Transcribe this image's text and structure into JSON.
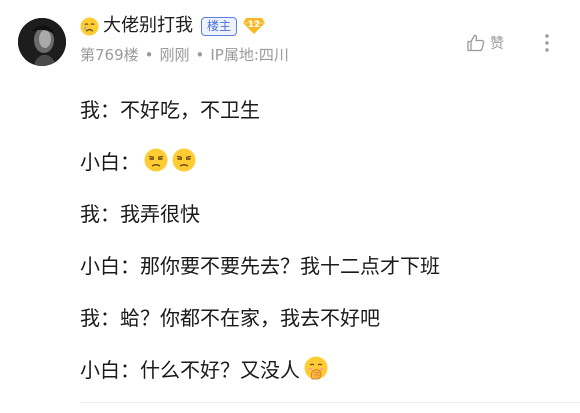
{
  "author": {
    "name": "大佬别打我",
    "name_emoji": "crying-face-icon",
    "op_badge": "楼主",
    "level": "12"
  },
  "meta": {
    "floor": "第769楼",
    "time": "刚刚",
    "ip": "IP属地:四川"
  },
  "actions": {
    "like_label": "赞",
    "like_icon": "thumbs-up-icon",
    "more_icon": "more-vertical-icon"
  },
  "messages": [
    {
      "speaker": "我：",
      "text": "不好吃，不卫生",
      "emojis": []
    },
    {
      "speaker": "小白：",
      "text": "",
      "emojis": [
        "unamused-face-icon",
        "unamused-face-icon"
      ]
    },
    {
      "speaker": "我：",
      "text": "我弄很快",
      "emojis": []
    },
    {
      "speaker": "小白：",
      "text": "那你要不要先去？我十二点才下班",
      "emojis": []
    },
    {
      "speaker": "我：",
      "text": "蛤？你都不在家，我去不好吧",
      "emojis": []
    },
    {
      "speaker": "小白：",
      "text": "什么不好？又没人",
      "emojis": [
        "face-with-hand-over-mouth-icon"
      ]
    }
  ],
  "colors": {
    "badge_blue": "#4a6fd8",
    "level_gold": "#f5b928",
    "meta_gray": "#9a9a9a",
    "text": "#1a1a1a"
  }
}
